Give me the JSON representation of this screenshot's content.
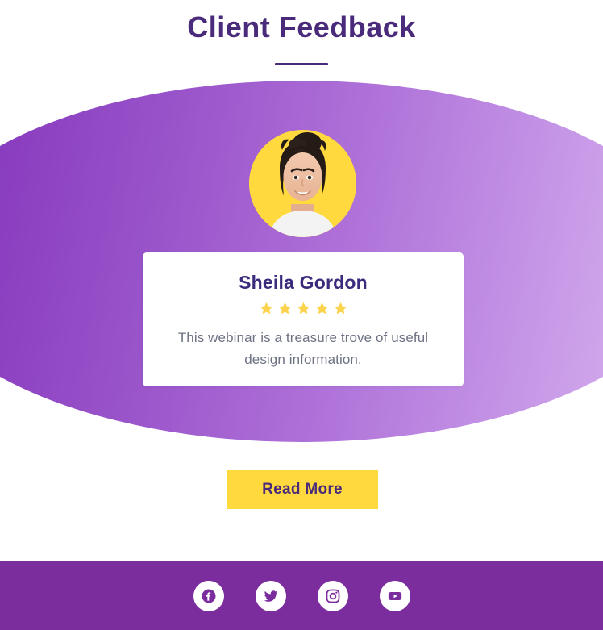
{
  "header": {
    "title": "Client Feedback",
    "divider": true
  },
  "testimonial": {
    "avatar_icon": "client-photo-avatar",
    "avatar_background_color": "#FFD93D",
    "name": "Sheila Gordon",
    "rating": 5,
    "max_rating": 5,
    "star_color": "#FCD34D",
    "quote": "This webinar is a treasure trove of useful design information.",
    "card_background_color": "#FFFFFF"
  },
  "cta": {
    "read_more_label": "Read More",
    "button_background_color": "#FFD93D",
    "button_text_color": "#4A2A7A"
  },
  "backdrop": {
    "shape": "ellipse",
    "gradient_from": "#7E2FB8",
    "gradient_to": "#DCB8F1"
  },
  "footer": {
    "background_color": "#7B2D9E",
    "social_links": [
      {
        "name": "facebook",
        "icon": "facebook-icon",
        "label": "Facebook"
      },
      {
        "name": "twitter",
        "icon": "twitter-icon",
        "label": "Twitter"
      },
      {
        "name": "instagram",
        "icon": "instagram-icon",
        "label": "Instagram"
      },
      {
        "name": "youtube",
        "icon": "youtube-icon",
        "label": "YouTube"
      }
    ]
  },
  "theme": {
    "title_color": "#4A2A7A",
    "name_color": "#3C2A7C",
    "quote_color": "#6E7384"
  }
}
